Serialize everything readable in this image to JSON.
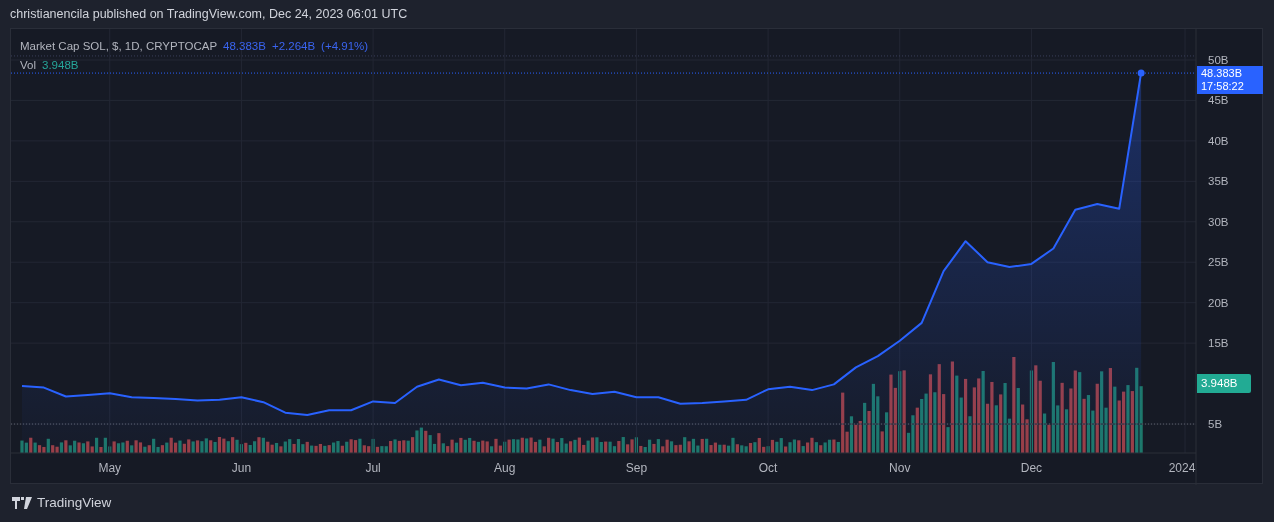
{
  "header": "christianencila published on TradingView.com, Dec 24, 2023 06:01 UTC",
  "legend": {
    "symbol_rest": ", $, 1D, CRYPTOCAP",
    "value": "48.383B",
    "change": "+2.264B",
    "change_pct": "(+4.91%)"
  },
  "volume_legend": {
    "label": "Vol",
    "value": "3.948B"
  },
  "price_label": {
    "value": "48.383B",
    "time": "17:58:22"
  },
  "volume_label": "3.948B",
  "chart": {
    "chart_data": {
      "type": "area",
      "categories": [
        null,
        null,
        null,
        null,
        "May",
        null,
        null,
        null,
        null,
        null,
        "Jun",
        null,
        null,
        null,
        null,
        null,
        "Jul",
        null,
        null,
        null,
        null,
        null,
        "Aug",
        null,
        null,
        null,
        null,
        null,
        "Sep",
        null,
        null,
        null,
        null,
        null,
        "Oct",
        null,
        null,
        null,
        null,
        null,
        "Nov",
        null,
        null,
        null,
        null,
        null,
        "Dec",
        null,
        null,
        null,
        null,
        null,
        null,
        "2024"
      ],
      "series": [
        {
          "name": "Market Cap SOL",
          "color": "#2962ff",
          "values": [
            9.7,
            9.5,
            8.4,
            8.6,
            8.8,
            8.3,
            8.2,
            8.1,
            7.9,
            8.0,
            8.3,
            7.7,
            6.4,
            6.1,
            6.7,
            6.7,
            7.8,
            7.6,
            9.6,
            10.5,
            9.8,
            10.1,
            9.5,
            9.4,
            9.9,
            9.2,
            8.7,
            9.0,
            8.3,
            8.3,
            7.5,
            7.6,
            7.8,
            8.0,
            9.3,
            9.6,
            9.2,
            9.9,
            12.0,
            13.4,
            15.3,
            17.5,
            23.9,
            27.6,
            25.0,
            24.4,
            24.8,
            26.7,
            31.5,
            32.2,
            31.6,
            48.4,
            null,
            null
          ]
        }
      ],
      "ylim": [
        1.42,
        53.83
      ],
      "grid": true,
      "ref_lines": [
        {
          "axis": "y",
          "value": 50.5,
          "color": "#3a3f5a"
        },
        {
          "axis": "y",
          "value": 48.383,
          "color": "#2962ff"
        },
        {
          "axis": "y",
          "value": 5,
          "color": "#5d606b"
        }
      ],
      "yticks": [
        {
          "value": 5,
          "label": "5B"
        },
        {
          "value": 15,
          "label": "15B"
        },
        {
          "value": 20,
          "label": "20B"
        },
        {
          "value": 25,
          "label": "25B"
        },
        {
          "value": 30,
          "label": "30B"
        },
        {
          "value": 35,
          "label": "35B"
        },
        {
          "value": 40,
          "label": "40B"
        },
        {
          "value": 45,
          "label": "45B"
        },
        {
          "value": 50,
          "label": "50B"
        }
      ]
    }
  },
  "footer": {
    "brand": "TradingView"
  }
}
